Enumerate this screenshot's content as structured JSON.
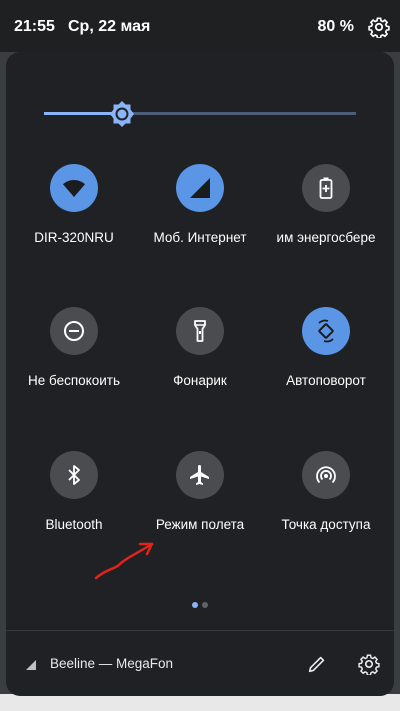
{
  "status_bar": {
    "time": "21:55",
    "date": "Ср, 22 мая",
    "battery": "80 %"
  },
  "brightness": {
    "level": 0.25
  },
  "colors": {
    "accent": "#5b95e6",
    "inactive": "#4a4c4f",
    "panel": "#202124",
    "annotation": "#e0241b"
  },
  "tiles": [
    {
      "label": "DIR-320NRU",
      "icon": "wifi-icon",
      "active": true
    },
    {
      "label": "Моб. Интернет",
      "icon": "mobile-data-icon",
      "active": true
    },
    {
      "label": "им энергосбере",
      "icon": "battery-saver-icon",
      "active": false
    },
    {
      "label": "Не беспокоить",
      "icon": "do-not-disturb-icon",
      "active": false
    },
    {
      "label": "Фонарик",
      "icon": "flashlight-icon",
      "active": false
    },
    {
      "label": "Автоповорот",
      "icon": "auto-rotate-icon",
      "active": true
    },
    {
      "label": "Bluetooth",
      "icon": "bluetooth-icon",
      "active": false
    },
    {
      "label": "Режим полета",
      "icon": "airplane-icon",
      "active": false
    },
    {
      "label": "Точка доступа",
      "icon": "hotspot-icon",
      "active": false
    }
  ],
  "pager": {
    "pages": 2,
    "current": 1
  },
  "footer": {
    "carrier": "Beeline — MegaFon"
  }
}
